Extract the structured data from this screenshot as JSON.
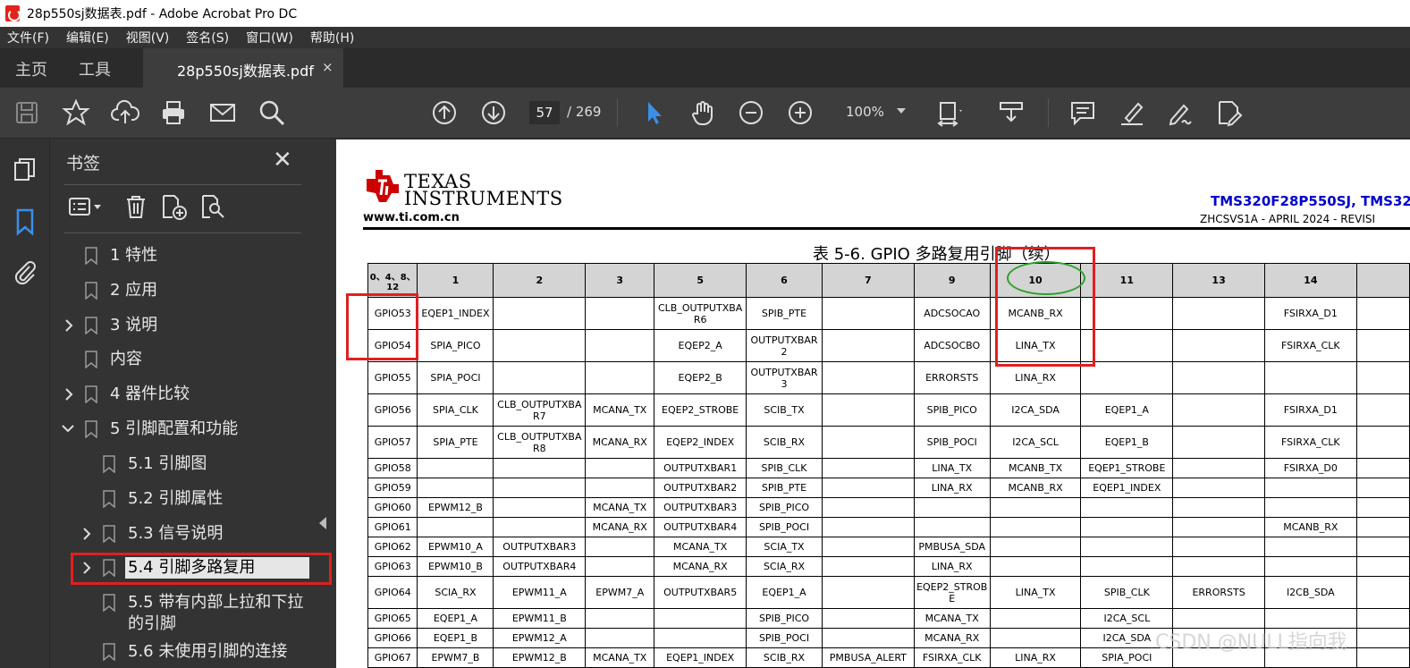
{
  "window": {
    "title": "28p550sj数据表.pdf - Adobe Acrobat Pro DC"
  },
  "menu": [
    "文件(F)",
    "编辑(E)",
    "视图(V)",
    "签名(S)",
    "窗口(W)",
    "帮助(H)"
  ],
  "tabs": {
    "home": "主页",
    "tools": "工具",
    "document": "28p550sj数据表.pdf",
    "close": "×"
  },
  "toolbar": {
    "page_current": "57",
    "page_total": "/ 269",
    "zoom": "100%"
  },
  "bookmarks": {
    "title": "书签",
    "close": "✕",
    "items": [
      {
        "label": "1 特性"
      },
      {
        "label": "2 应用"
      },
      {
        "label": "3 说明"
      },
      {
        "label": "内容"
      },
      {
        "label": "4 器件比较"
      },
      {
        "label": "5 引脚配置和功能"
      },
      {
        "label": "5.1 引脚图"
      },
      {
        "label": "5.2 引脚属性"
      },
      {
        "label": "5.3 信号说明"
      },
      {
        "label": "5.4 引脚多路复用"
      },
      {
        "label": "5.5 带有内部上拉和下拉的引脚"
      },
      {
        "label": "5.6 未使用引脚的连接"
      }
    ]
  },
  "document": {
    "logo_line1": "TEXAS",
    "logo_line2": "INSTRUMENTS",
    "website": "www.ti.com.cn",
    "doc_id": "TMS320F28P550SJ, TMS32",
    "doc_rev": "ZHCSVS1A  -  APRIL 2024  -  REVISI",
    "table_title": "表 5-6. GPIO 多路复用引脚（续）",
    "table": {
      "headers": [
        "0、4、8、12",
        "1",
        "2",
        "3",
        "5",
        "6",
        "7",
        "9",
        "10",
        "11",
        "13",
        "14",
        ""
      ],
      "rows": [
        [
          "GPIO53",
          "EQEP1_INDEX",
          "",
          "",
          "CLB_OUTPUTXBAR6",
          "SPIB_PTE",
          "",
          "ADCSOCAO",
          "MCANB_RX",
          "",
          "",
          "FSIRXA_D1",
          ""
        ],
        [
          "GPIO54",
          "SPIA_PICO",
          "",
          "",
          "EQEP2_A",
          "OUTPUTXBAR2",
          "",
          "ADCSOCBO",
          "LINA_TX",
          "",
          "",
          "FSIRXA_CLK",
          ""
        ],
        [
          "GPIO55",
          "SPIA_POCI",
          "",
          "",
          "EQEP2_B",
          "OUTPUTXBAR3",
          "",
          "ERRORSTS",
          "LINA_RX",
          "",
          "",
          "",
          ""
        ],
        [
          "GPIO56",
          "SPIA_CLK",
          "CLB_OUTPUTXBAR7",
          "MCANA_TX",
          "EQEP2_STROBE",
          "SCIB_TX",
          "",
          "SPIB_PICO",
          "I2CA_SDA",
          "EQEP1_A",
          "",
          "FSIRXA_D1",
          ""
        ],
        [
          "GPIO57",
          "SPIA_PTE",
          "CLB_OUTPUTXBAR8",
          "MCANA_RX",
          "EQEP2_INDEX",
          "SCIB_RX",
          "",
          "SPIB_POCI",
          "I2CA_SCL",
          "EQEP1_B",
          "",
          "FSIRXA_CLK",
          ""
        ],
        [
          "GPIO58",
          "",
          "",
          "",
          "OUTPUTXBAR1",
          "SPIB_CLK",
          "",
          "LINA_TX",
          "MCANB_TX",
          "EQEP1_STROBE",
          "",
          "FSIRXA_D0",
          ""
        ],
        [
          "GPIO59",
          "",
          "",
          "",
          "OUTPUTXBAR2",
          "SPIB_PTE",
          "",
          "LINA_RX",
          "MCANB_RX",
          "EQEP1_INDEX",
          "",
          "",
          ""
        ],
        [
          "GPIO60",
          "EPWM12_B",
          "",
          "MCANA_TX",
          "OUTPUTXBAR3",
          "SPIB_PICO",
          "",
          "",
          "",
          "",
          "",
          "",
          ""
        ],
        [
          "GPIO61",
          "",
          "",
          "MCANA_RX",
          "OUTPUTXBAR4",
          "SPIB_POCI",
          "",
          "",
          "",
          "",
          "",
          "MCANB_RX",
          ""
        ],
        [
          "GPIO62",
          "EPWM10_A",
          "OUTPUTXBAR3",
          "",
          "MCANA_TX",
          "SCIA_TX",
          "",
          "PMBUSA_SDA",
          "",
          "",
          "",
          "",
          ""
        ],
        [
          "GPIO63",
          "EPWM10_B",
          "OUTPUTXBAR4",
          "",
          "MCANA_RX",
          "SCIA_RX",
          "",
          "LINA_RX",
          "",
          "",
          "",
          "",
          ""
        ],
        [
          "GPIO64",
          "SCIA_RX",
          "EPWM11_A",
          "EPWM7_A",
          "OUTPUTXBAR5",
          "EQEP1_A",
          "",
          "EQEP2_STROBE",
          "LINA_TX",
          "SPIB_CLK",
          "ERRORSTS",
          "I2CB_SDA",
          ""
        ],
        [
          "GPIO65",
          "EQEP1_A",
          "EPWM11_B",
          "",
          "",
          "SPIB_PICO",
          "",
          "MCANA_TX",
          "",
          "I2CA_SCL",
          "",
          "",
          ""
        ],
        [
          "GPIO66",
          "EQEP1_B",
          "EPWM12_A",
          "",
          "",
          "SPIB_POCI",
          "",
          "MCANA_RX",
          "",
          "I2CA_SDA",
          "",
          "",
          ""
        ],
        [
          "GPIO67",
          "EPWM7_B",
          "EPWM12_B",
          "MCANA_TX",
          "EQEP1_INDEX",
          "SCIB_RX",
          "PMBUSA_ALERT",
          "FSIRXA_CLK",
          "LINA_RX",
          "SPIA_POCI",
          "",
          "",
          ""
        ]
      ]
    }
  },
  "watermark": "CSDN @NULL指向我",
  "colors": {
    "annotation_red": "#e02020",
    "annotation_green": "#2ca02c",
    "ti_red": "#cc0000",
    "doc_blue": "#0000cc"
  }
}
